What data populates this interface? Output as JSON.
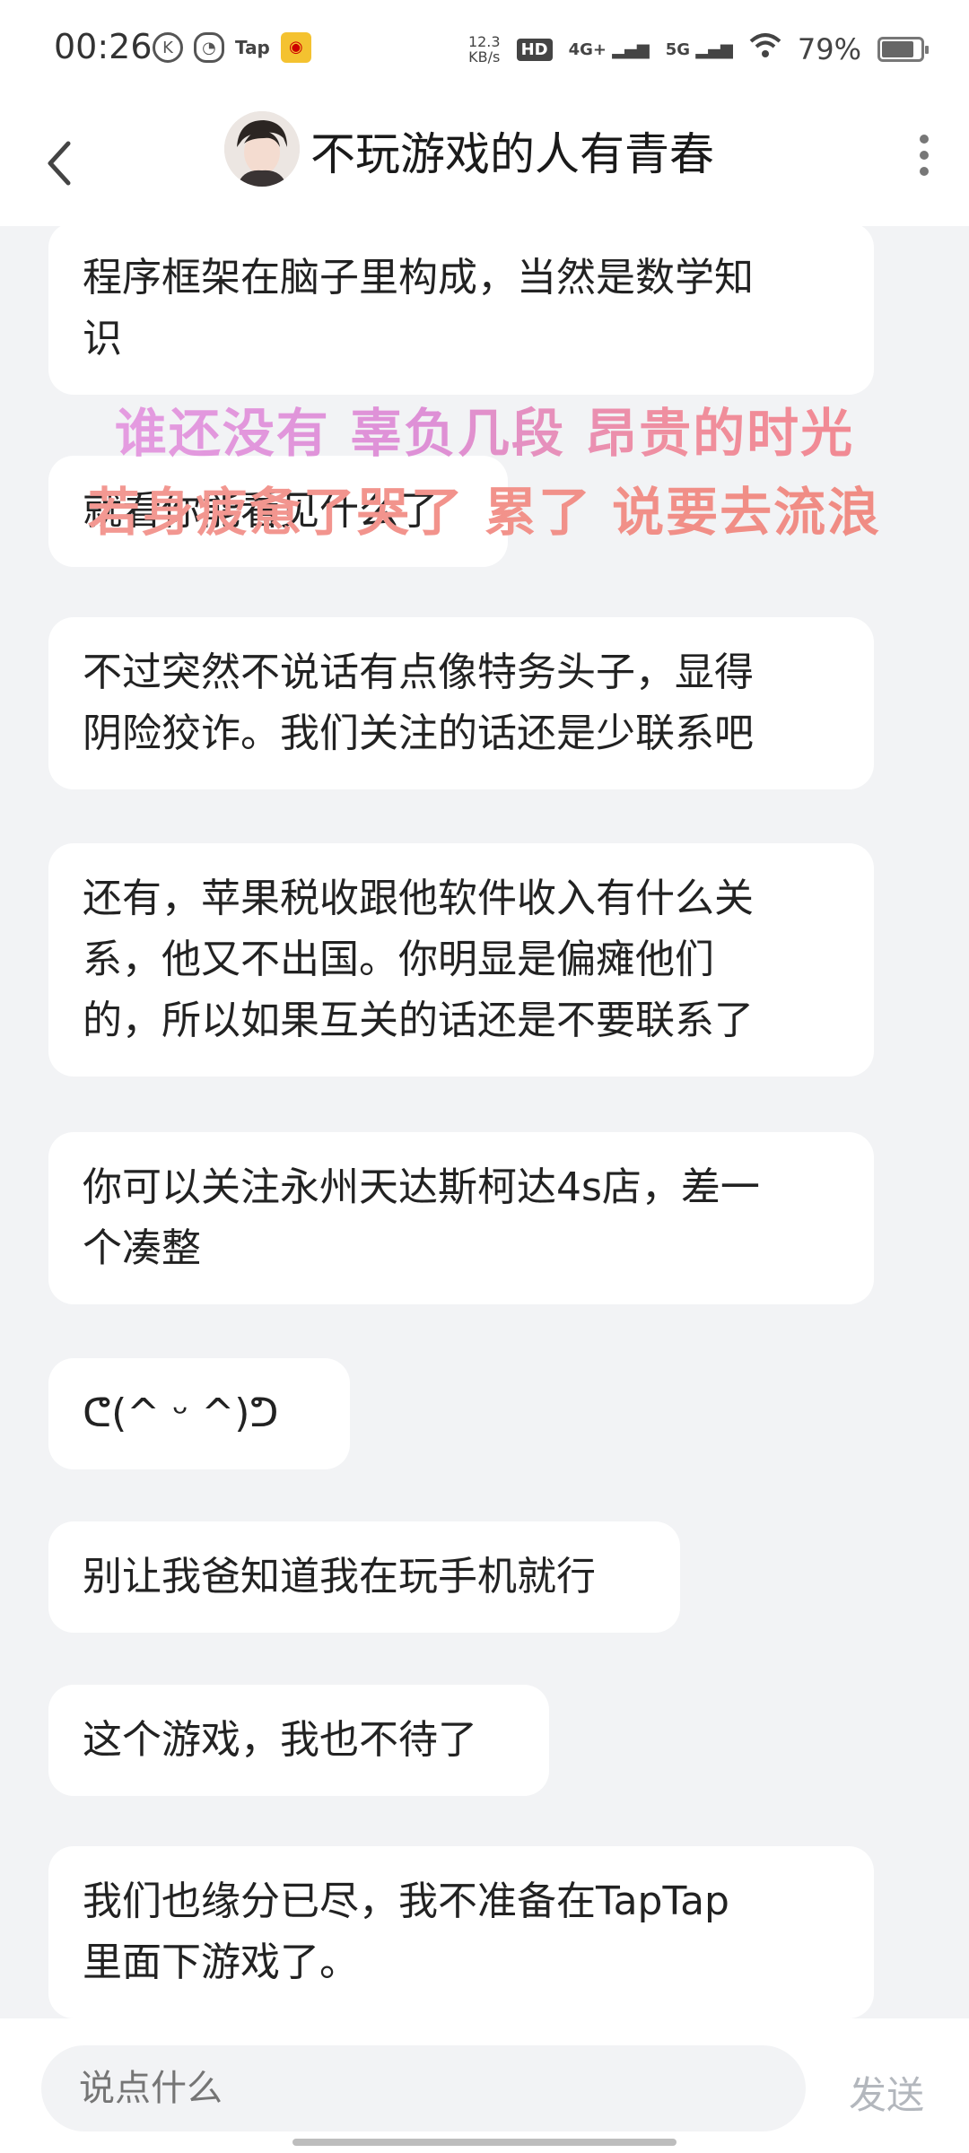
{
  "status_bar": {
    "time": "00:26",
    "tap_label": "Tap",
    "net_speed_value": "12.3",
    "net_speed_unit": "KB/s",
    "hd_label": "HD",
    "signal_4g": "4G+",
    "signal_5g": "5G",
    "battery_percent": "79%",
    "battery_level": 0.79
  },
  "header": {
    "title": "不玩游戏的人有青春"
  },
  "overlay": {
    "line1": "谁还没有 辜负几段 昂贵的时光",
    "line2": "若身疲惫了哭了 累了 说要去流浪"
  },
  "messages": [
    {
      "text": "程序框架在脑子里构成，当然是数学知\n识"
    },
    {
      "text": "就看你能看见什么了"
    },
    {
      "text": "不过突然不说话有点像特务头子，显得\n阴险狡诈。我们关注的话还是少联系吧"
    },
    {
      "text": "还有，苹果税收跟他软件收入有什么关\n系，他又不出国。你明显是偏瘫他们\n的，所以如果互关的话还是不要联系了"
    },
    {
      "text": "你可以关注永州天达斯柯达4s店，差一\n个凑整"
    },
    {
      "text": "ᕦ(^ ᵕ ^)ᕤ"
    },
    {
      "text": "别让我爸知道我在玩手机就行"
    },
    {
      "text": "这个游戏，我也不待了"
    },
    {
      "text": "我们也缘分已尽，我不准备在TapTap\n里面下游戏了。"
    }
  ],
  "input": {
    "placeholder": "说点什么",
    "send_label": "发送"
  }
}
